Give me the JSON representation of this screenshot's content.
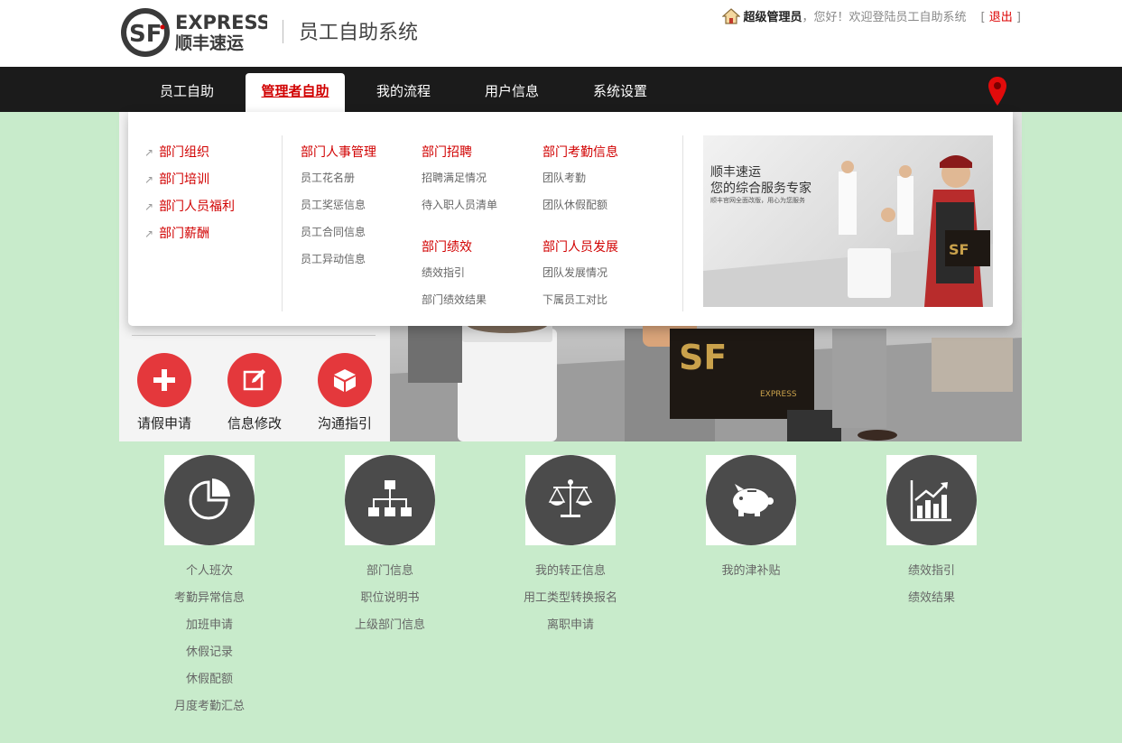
{
  "header": {
    "logo_top": "EXPRESS",
    "logo_bottom": "顺丰速运",
    "system_title": "员工自助系统",
    "user_role": "超级管理员",
    "greeting": "，您好！欢迎登陆员工自助系统",
    "bracket_open": "[",
    "bracket_close": "]",
    "logout": "退出"
  },
  "nav": {
    "items": [
      {
        "label": "员工自助"
      },
      {
        "label": "管理者自助"
      },
      {
        "label": "我的流程"
      },
      {
        "label": "用户信息"
      },
      {
        "label": "系统设置"
      }
    ],
    "active": "管理者自助"
  },
  "mega_menu": {
    "side_links": [
      "部门组织",
      "部门培训",
      "部门人员福利",
      "部门薪酬"
    ],
    "groups": [
      {
        "title": "部门人事管理",
        "items": [
          "员工花名册",
          "员工奖惩信息",
          "员工合同信息",
          "员工异动信息"
        ]
      },
      {
        "title": "部门招聘",
        "items": [
          "招聘满足情况",
          "待入职人员清单"
        ]
      },
      {
        "title": "部门考勤信息",
        "items": [
          "团队考勤",
          "团队休假配额"
        ]
      },
      {
        "title": "部门绩效",
        "items": [
          "绩效指引",
          "部门绩效结果"
        ]
      },
      {
        "title": "部门人员发展",
        "items": [
          "团队发展情况",
          "下属员工对比"
        ]
      }
    ],
    "promo": {
      "line1": "顺丰速运",
      "line2": "您的综合服务专家",
      "line3": "顺丰官网全面改版，用心为您服务"
    }
  },
  "quick_actions": [
    {
      "label": "请假申请",
      "icon": "plus-icon"
    },
    {
      "label": "信息修改",
      "icon": "edit-icon"
    },
    {
      "label": "沟通指引",
      "icon": "box-icon"
    }
  ],
  "modules": [
    {
      "icon": "pie-chart-icon",
      "links": [
        "个人班次",
        "考勤异常信息",
        "加班申请",
        "休假记录",
        "休假配额",
        "月度考勤汇总"
      ]
    },
    {
      "icon": "org-chart-icon",
      "links": [
        "部门信息",
        "职位说明书",
        "上级部门信息"
      ]
    },
    {
      "icon": "scales-icon",
      "links": [
        "我的转正信息",
        "用工类型转换报名",
        "离职申请"
      ]
    },
    {
      "icon": "piggy-bank-icon",
      "links": [
        "我的津补贴"
      ]
    },
    {
      "icon": "growth-chart-icon",
      "links": [
        "绩效指引",
        "绩效结果"
      ]
    }
  ],
  "colors": {
    "brand_red": "#d10000",
    "page_bg": "#c8ebcb",
    "nav_bg": "#1b1b1b",
    "quick_circle": "#e4383c",
    "module_circle": "#4b4b4b"
  }
}
